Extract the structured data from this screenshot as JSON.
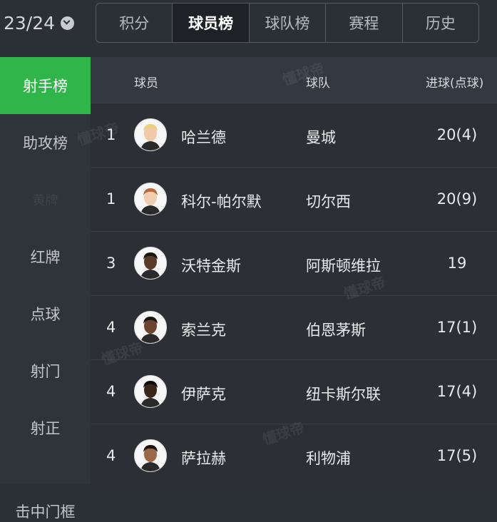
{
  "season": {
    "label": "23/24"
  },
  "tabs": [
    {
      "label": "积分",
      "active": false
    },
    {
      "label": "球员榜",
      "active": true
    },
    {
      "label": "球队榜",
      "active": false
    },
    {
      "label": "赛程",
      "active": false
    },
    {
      "label": "历史",
      "active": false
    }
  ],
  "sidebar": {
    "items": [
      {
        "label": "射手榜"
      },
      {
        "label": "助攻榜"
      },
      {
        "label": "黄牌"
      },
      {
        "label": "红牌"
      },
      {
        "label": "点球"
      },
      {
        "label": "射门"
      },
      {
        "label": "射正"
      },
      {
        "label": "击中门框"
      }
    ]
  },
  "table": {
    "headers": {
      "player": "球员",
      "team": "球队",
      "goals": "进球(点球)"
    },
    "rows": [
      {
        "rank": "1",
        "player": "哈兰德",
        "team": "曼城",
        "goals": "20(4)",
        "skin": "#f0c9a8",
        "hair": "#e8d27a"
      },
      {
        "rank": "1",
        "player": "科尔-帕尔默",
        "team": "切尔西",
        "goals": "20(9)",
        "skin": "#f1cdb0",
        "hair": "#b86a3a"
      },
      {
        "rank": "3",
        "player": "沃特金斯",
        "team": "阿斯顿维拉",
        "goals": "19",
        "skin": "#5a3a28",
        "hair": "#1c1410"
      },
      {
        "rank": "4",
        "player": "索兰克",
        "team": "伯恩茅斯",
        "goals": "17(1)",
        "skin": "#6b4530",
        "hair": "#1a1410"
      },
      {
        "rank": "4",
        "player": "伊萨克",
        "team": "纽卡斯尔联",
        "goals": "17(4)",
        "skin": "#3b2519",
        "hair": "#120c08"
      },
      {
        "rank": "4",
        "player": "萨拉赫",
        "team": "利物浦",
        "goals": "17(5)",
        "skin": "#9a6a48",
        "hair": "#1a120c"
      }
    ]
  },
  "watermark": "懂球帝"
}
